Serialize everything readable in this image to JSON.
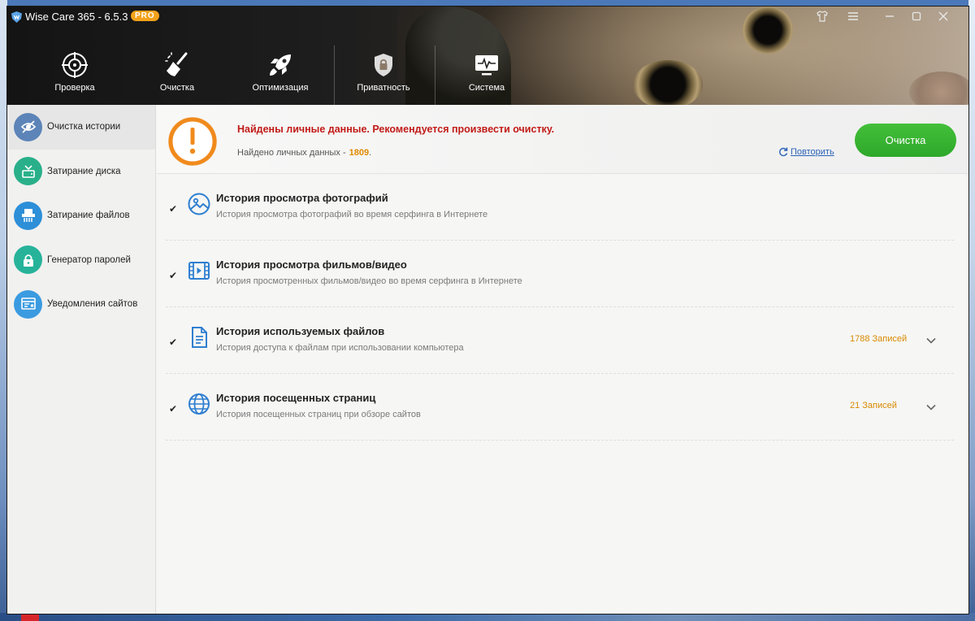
{
  "app": {
    "title": "Wise Care 365 - 6.5.3",
    "badge": "PRO"
  },
  "nav": {
    "tabs": [
      {
        "label": "Проверка",
        "icon": "target-icon"
      },
      {
        "label": "Очистка",
        "icon": "broom-icon"
      },
      {
        "label": "Оптимизация",
        "icon": "rocket-icon"
      },
      {
        "label": "Приватность",
        "icon": "shield-lock-icon",
        "active": true
      },
      {
        "label": "Система",
        "icon": "monitor-pulse-icon"
      }
    ]
  },
  "window_controls": [
    "skin-icon",
    "menu-icon",
    "minimize-icon",
    "maximize-icon",
    "close-icon"
  ],
  "sidebar": {
    "items": [
      {
        "label": "Очистка истории",
        "icon": "eye-slash-icon",
        "color": "#5c84b8",
        "active": true
      },
      {
        "label": "Затирание диска",
        "icon": "disk-wipe-icon",
        "color": "#29b08a"
      },
      {
        "label": "Затирание файлов",
        "icon": "shredder-icon",
        "color": "#2d8fd8"
      },
      {
        "label": "Генератор паролей",
        "icon": "lock-icon",
        "color": "#27b39a"
      },
      {
        "label": "Уведомления сайтов",
        "icon": "notification-icon",
        "color": "#3b9be0"
      }
    ]
  },
  "alert": {
    "title": "Найдены личные данные. Рекомендуется произвести очистку.",
    "found_label": "Найдено личных данных -",
    "found_count": "1809",
    "found_suffix": ".",
    "retry_label": "Повторить",
    "clean_button": "Очистка"
  },
  "items": [
    {
      "title": "История просмотра фотографий",
      "desc": "История просмотра фотографий во время серфинга в Интернете",
      "icon": "photo-icon",
      "checked": true,
      "count": ""
    },
    {
      "title": "История просмотра фильмов/видео",
      "desc": "История просмотренных фильмов/видео во время серфинга в Интернете",
      "icon": "video-icon",
      "checked": true,
      "count": ""
    },
    {
      "title": "История используемых файлов",
      "desc": "История доступа к файлам при использовании компьютера",
      "icon": "document-icon",
      "checked": true,
      "count": "1788 Записей"
    },
    {
      "title": "История посещенных страниц",
      "desc": "История посещенных страниц при обзоре сайтов",
      "icon": "globe-icon",
      "checked": true,
      "count": "21 Записей"
    }
  ],
  "colors": {
    "accent_green": "#35ad2f",
    "alert_red": "#c11b17",
    "count_orange": "#d98a00",
    "icon_blue": "#2f7fd0",
    "alert_icon_orange": "#f08a1c"
  }
}
